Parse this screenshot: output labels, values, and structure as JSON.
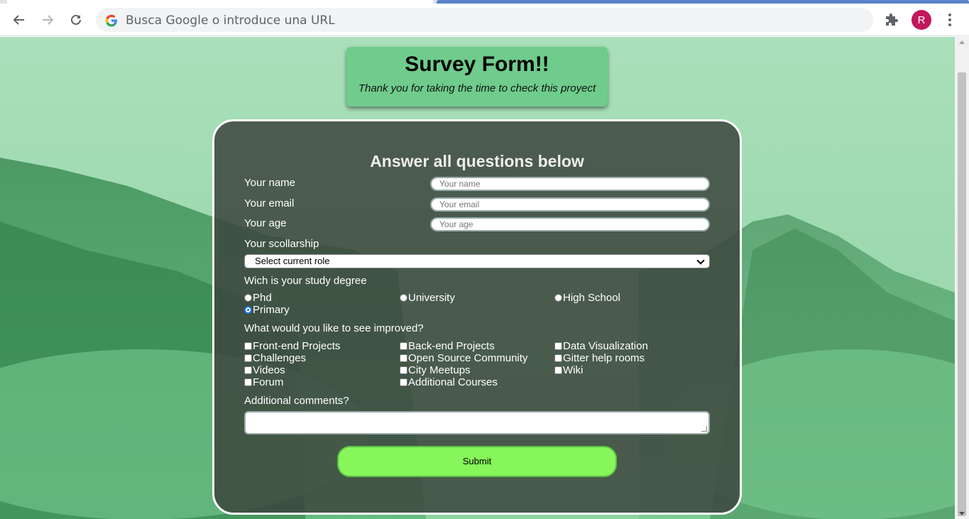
{
  "browser": {
    "address_placeholder": "Busca Google o introduce una URL",
    "avatar_letter": "R",
    "avatar_color": "#c2185b"
  },
  "header": {
    "title": "Survey Form!!",
    "subtitle": "Thank you for taking the time to check this proyect"
  },
  "form": {
    "heading": "Answer all questions below",
    "name_label": "Your name",
    "name_placeholder": "Your name",
    "email_label": "Your email",
    "email_placeholder": "Your email",
    "age_label": "Your age",
    "age_placeholder": "Your age",
    "scholarship_label": "Your scollarship",
    "scholarship_selected": "Select current role",
    "degree_label": "Wich is your study degree",
    "degree_options": [
      "Phd",
      "University",
      "High School",
      "Primary"
    ],
    "degree_selected": "Primary",
    "improve_label": "What would you like to see improved?",
    "improve_options": [
      "Front-end Projects",
      "Back-end Projects",
      "Data Visualization",
      "Challenges",
      "Open Source Community",
      "Gitter help rooms",
      "Videos",
      "City Meetups",
      "Wiki",
      "Forum",
      "Additional Courses"
    ],
    "comments_label": "Additional comments?",
    "submit_label": "Submit"
  },
  "colors": {
    "header_card": "#6fcc8c",
    "form_card": "#3c463e",
    "submit": "#86f65b",
    "radio_selected": "#1a73e8"
  }
}
